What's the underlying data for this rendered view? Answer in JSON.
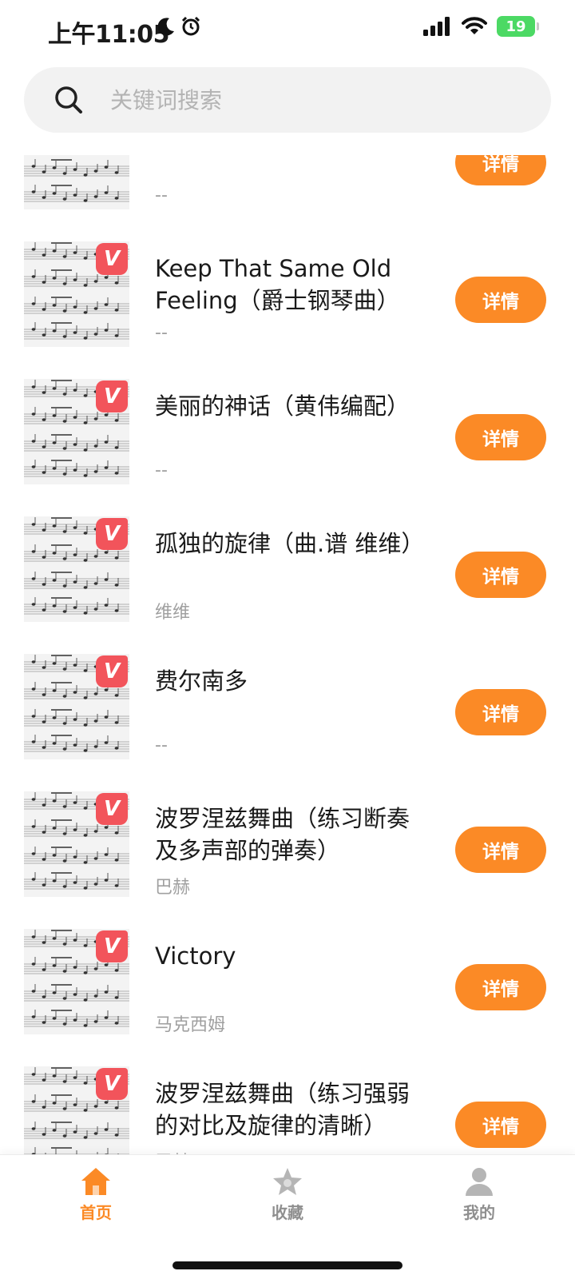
{
  "status_bar": {
    "time": "上午11:05",
    "battery": "19"
  },
  "search": {
    "placeholder": "关键词搜索"
  },
  "items": [
    {
      "title": "",
      "author": "--",
      "button": "详情",
      "vip": ""
    },
    {
      "title": "Keep That Same Old Feeling（爵士钢琴曲）",
      "author": "--",
      "button": "详情",
      "vip": "V"
    },
    {
      "title": "美丽的神话（黄伟编配）",
      "author": "--",
      "button": "详情",
      "vip": "V"
    },
    {
      "title": "孤独的旋律（曲.谱 维维）",
      "author": "维维",
      "button": "详情",
      "vip": "V"
    },
    {
      "title": "费尔南多",
      "author": "--",
      "button": "详情",
      "vip": "V"
    },
    {
      "title": "波罗涅兹舞曲（练习断奏及多声部的弹奏）",
      "author": "巴赫",
      "button": "详情",
      "vip": "V"
    },
    {
      "title": "Victory",
      "author": "马克西姆",
      "button": "详情",
      "vip": "V"
    },
    {
      "title": "波罗涅兹舞曲（练习强弱的对比及旋律的清晰）",
      "author": "巴赫",
      "button": "详情",
      "vip": "V"
    }
  ],
  "tabs": [
    {
      "label": "首页",
      "icon": "home-icon",
      "active": true
    },
    {
      "label": "收藏",
      "icon": "star-icon",
      "active": false
    },
    {
      "label": "我的",
      "icon": "user-icon",
      "active": false
    }
  ],
  "colors": {
    "accent": "#fb8a26",
    "vip": "#f2545b"
  }
}
